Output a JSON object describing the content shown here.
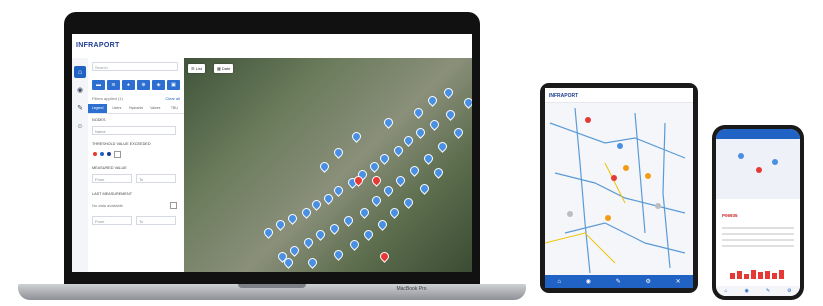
{
  "laptop": {
    "model": "MacBook Pro",
    "app": {
      "logo": "INFRAPORT",
      "rail": [
        {
          "icon": "home-icon"
        },
        {
          "icon": "eye-icon"
        },
        {
          "icon": "pencil-icon"
        },
        {
          "icon": "users-icon"
        }
      ],
      "panel": {
        "search_placeholder": "Search",
        "filter_text": "Filters applied (1)",
        "clear_label": "Clear all",
        "tabs": [
          "Legend",
          "Users",
          "Hydrants",
          "Valves",
          "TBU"
        ],
        "active_tab": "Legend",
        "sec_nodes": "Nodes",
        "nodes_field": "Name",
        "sec_threshold": "Threshold value exceeded",
        "sec_measured": "Measured value",
        "from_placeholder": "From",
        "to_placeholder": "To",
        "sec_last": "Last measurement",
        "no_data": "No data available"
      },
      "map_buttons": {
        "list": "List",
        "date": "Date"
      }
    }
  },
  "tablet": {
    "logo": "INFRAPORT"
  },
  "phone": {
    "title": "P06935"
  },
  "colors": {
    "brand": "#2163c4",
    "marker_blue": "#4a90e2",
    "marker_red": "#e53935"
  }
}
